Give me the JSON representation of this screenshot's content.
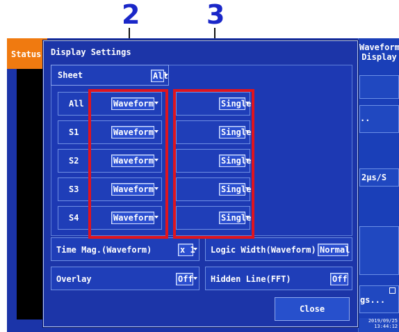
{
  "callouts": {
    "left": "2",
    "right": "3"
  },
  "background": {
    "status_tab": "Status",
    "waveform_display": "Waveform Display",
    "timebase": "2μs/S",
    "settings_btn": "gs...",
    "ellipsis": "..",
    "date": "2019/09/25",
    "time": "13:44:12"
  },
  "dialog": {
    "title": "Display Settings",
    "sheet": {
      "label": "Sheet",
      "value": "All"
    },
    "rows": [
      {
        "name": "All",
        "type": "Waveform",
        "mode": "Single"
      },
      {
        "name": "S1",
        "type": "Waveform",
        "mode": "Single"
      },
      {
        "name": "S2",
        "type": "Waveform",
        "mode": "Single"
      },
      {
        "name": "S3",
        "type": "Waveform",
        "mode": "Single"
      },
      {
        "name": "S4",
        "type": "Waveform",
        "mode": "Single"
      }
    ],
    "time_mag": {
      "label": "Time Mag.(Waveform)",
      "value": "x 1"
    },
    "logic_width": {
      "label": "Logic Width(Waveform)",
      "value": "Normal"
    },
    "overlay": {
      "label": "Overlay",
      "value": "Off"
    },
    "hidden_line": {
      "label": "Hidden Line(FFT)",
      "value": "Off"
    },
    "close_label": "Close"
  }
}
